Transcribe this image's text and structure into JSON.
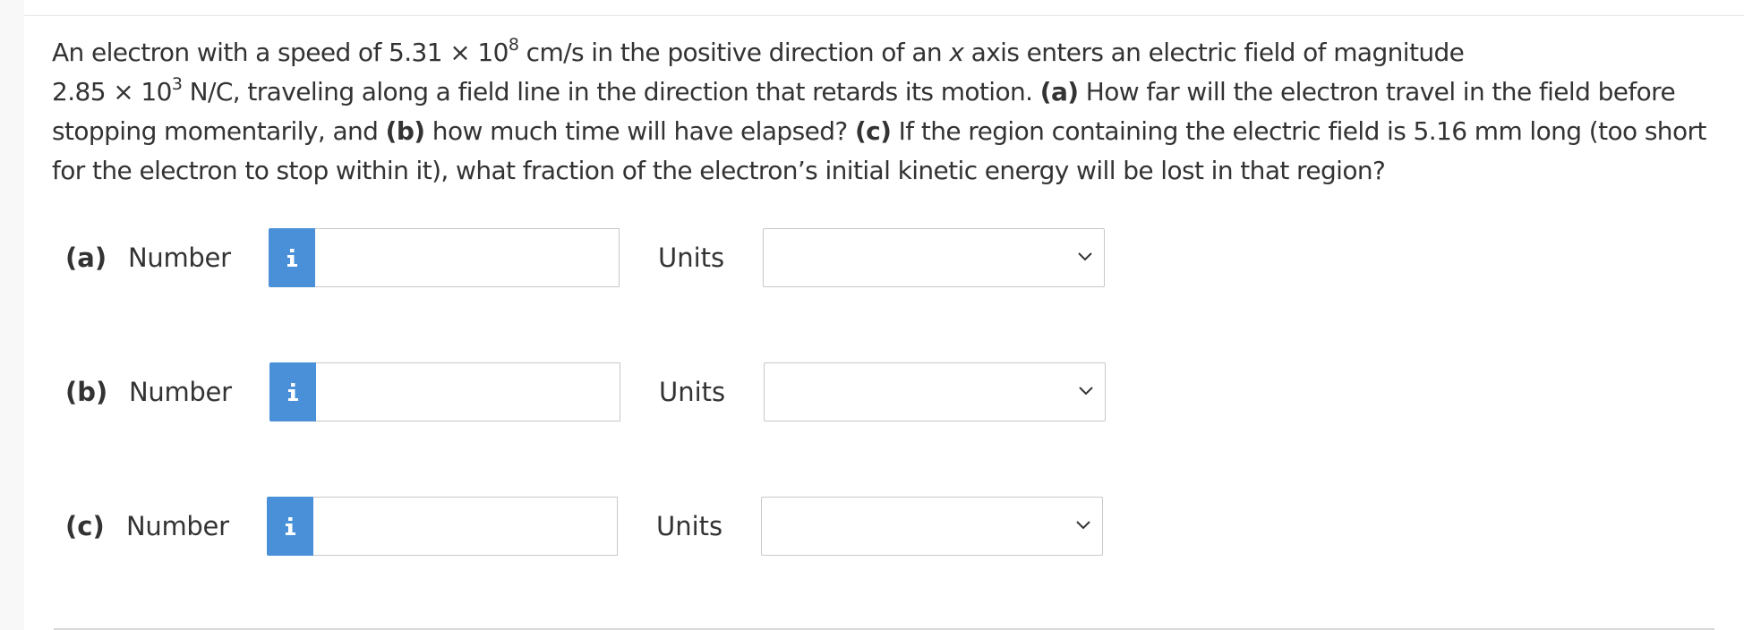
{
  "question": {
    "t1": "An electron with a speed of 5.31 × 10",
    "exp1": "8",
    "t2": " cm/s in the positive direction of an ",
    "xvar": "x",
    "t3": " axis enters an electric field of magnitude",
    "t4": "2.85 × 10",
    "exp2": "3",
    "t5": " N/C, traveling along a field line in the direction that retards its motion. ",
    "a_marker": "(a)",
    "t6": " How far will the electron travel in the field before stopping momentarily, and ",
    "b_marker": "(b)",
    "t7": " how much time will have elapsed? ",
    "c_marker": "(c)",
    "t8": " If the region containing the electric field is 5.16 mm long (too short for the electron to stop within it), what fraction of the electron’s initial kinetic energy will be lost in that region?"
  },
  "parts": [
    {
      "label": "(a)",
      "number_label": "Number",
      "info_symbol": "i",
      "number_value": "",
      "units_label": "Units",
      "units_value": ""
    },
    {
      "label": "(b)",
      "number_label": "Number",
      "info_symbol": "i",
      "number_value": "",
      "units_label": "Units",
      "units_value": ""
    },
    {
      "label": "(c)",
      "number_label": "Number",
      "info_symbol": "i",
      "number_value": "",
      "units_label": "Units",
      "units_value": ""
    }
  ],
  "icons": {
    "info": "info-icon",
    "dropdown": "chevron-down-icon"
  },
  "colors": {
    "info_button": "#4a90d9",
    "text": "#333333",
    "input_border": "#c8c8c8"
  }
}
